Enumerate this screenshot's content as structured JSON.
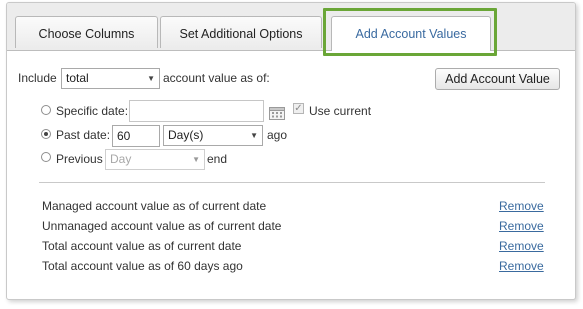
{
  "tabs": [
    {
      "label": "Choose Columns"
    },
    {
      "label": "Set Additional Options"
    },
    {
      "label": "Add Account Values"
    }
  ],
  "form": {
    "include_label": "Include",
    "include_value": "total",
    "as_of_label": "account value as of:",
    "add_button_label": "Add Account Value",
    "specific_date": {
      "label": "Specific date:",
      "value": "",
      "selected": false
    },
    "use_current_label": "Use current",
    "use_current_checked": true,
    "past_date": {
      "label": "Past date:",
      "value": "60",
      "unit": "Day(s)",
      "suffix": "ago",
      "selected": true
    },
    "previous": {
      "label": "Previous",
      "unit": "Day",
      "suffix": "end",
      "selected": false
    }
  },
  "values_list": {
    "remove_label": "Remove",
    "items": [
      "Managed account value as of current date",
      "Unmanaged account value as of current date",
      "Total account value as of current date",
      "Total account value as of 60 days ago"
    ]
  },
  "colors": {
    "highlight": "#6aa637",
    "link": "#3a6a9e",
    "active_tab_text": "#3a6aa0"
  }
}
